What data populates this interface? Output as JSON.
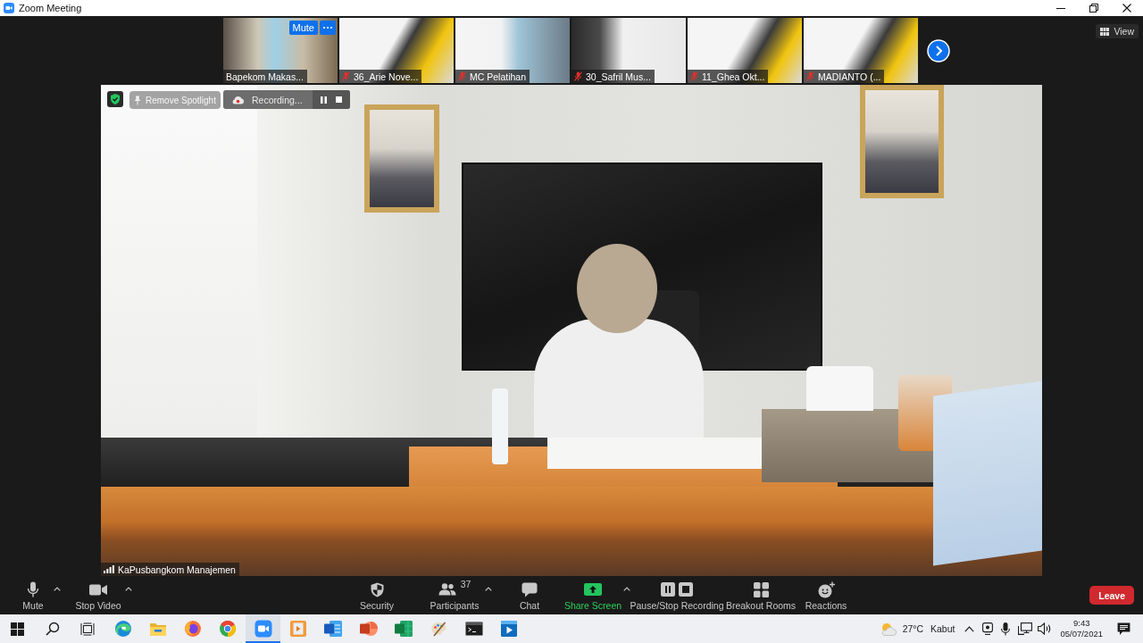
{
  "window": {
    "title": "Zoom Meeting"
  },
  "gallery": {
    "hover_button_label": "Mute",
    "thumbnails": [
      {
        "name": "Bapekom Makas...",
        "muted": false,
        "hovered": true
      },
      {
        "name": "36_Arie Nove...",
        "muted": true,
        "hovered": false
      },
      {
        "name": "MC Pelatihan",
        "muted": true,
        "hovered": false
      },
      {
        "name": "30_Safril Mus...",
        "muted": true,
        "hovered": false
      },
      {
        "name": "11_Ghea Okt...",
        "muted": true,
        "hovered": false
      },
      {
        "name": "MADIANTO (...",
        "muted": true,
        "hovered": false
      }
    ]
  },
  "view_button": {
    "label": "View"
  },
  "main_video": {
    "remove_spotlight_label": "Remove Spotlight",
    "recording_label": "Recording...",
    "speaker_name": "KaPusbangkom Manajemen"
  },
  "toolbar": {
    "items": [
      {
        "kind": "mic",
        "label": "Mute",
        "menu": true
      },
      {
        "kind": "video",
        "label": "Stop Video",
        "menu": true
      },
      {
        "kind": "security",
        "label": "Security",
        "menu": false
      },
      {
        "kind": "participants",
        "label": "Participants",
        "count": "37",
        "menu": true
      },
      {
        "kind": "chat",
        "label": "Chat",
        "menu": false
      },
      {
        "kind": "share",
        "label": "Share Screen",
        "menu": true
      },
      {
        "kind": "recording",
        "label": "Pause/Stop Recording",
        "menu": false
      },
      {
        "kind": "breakout",
        "label": "Breakout Rooms",
        "menu": false
      },
      {
        "kind": "reactions",
        "label": "Reactions",
        "menu": false
      }
    ],
    "leave_label": "Leave"
  },
  "taskbar": {
    "buttons": [
      {
        "kind": "start",
        "active": false
      },
      {
        "kind": "search",
        "active": false
      },
      {
        "kind": "taskview",
        "active": false
      },
      {
        "kind": "edge",
        "active": false
      },
      {
        "kind": "folder",
        "active": false
      },
      {
        "kind": "firefox",
        "active": false
      },
      {
        "kind": "chrome",
        "active": false
      },
      {
        "kind": "zoom",
        "active": true
      },
      {
        "kind": "film",
        "active": false
      },
      {
        "kind": "word",
        "active": false
      },
      {
        "kind": "powerpoint",
        "active": false
      },
      {
        "kind": "excel",
        "active": false
      },
      {
        "kind": "paint",
        "active": false
      },
      {
        "kind": "terminal",
        "active": false
      },
      {
        "kind": "player",
        "active": false
      }
    ],
    "weather": "27°C Kabut",
    "time": "9:43",
    "date": "05/07/2021"
  }
}
